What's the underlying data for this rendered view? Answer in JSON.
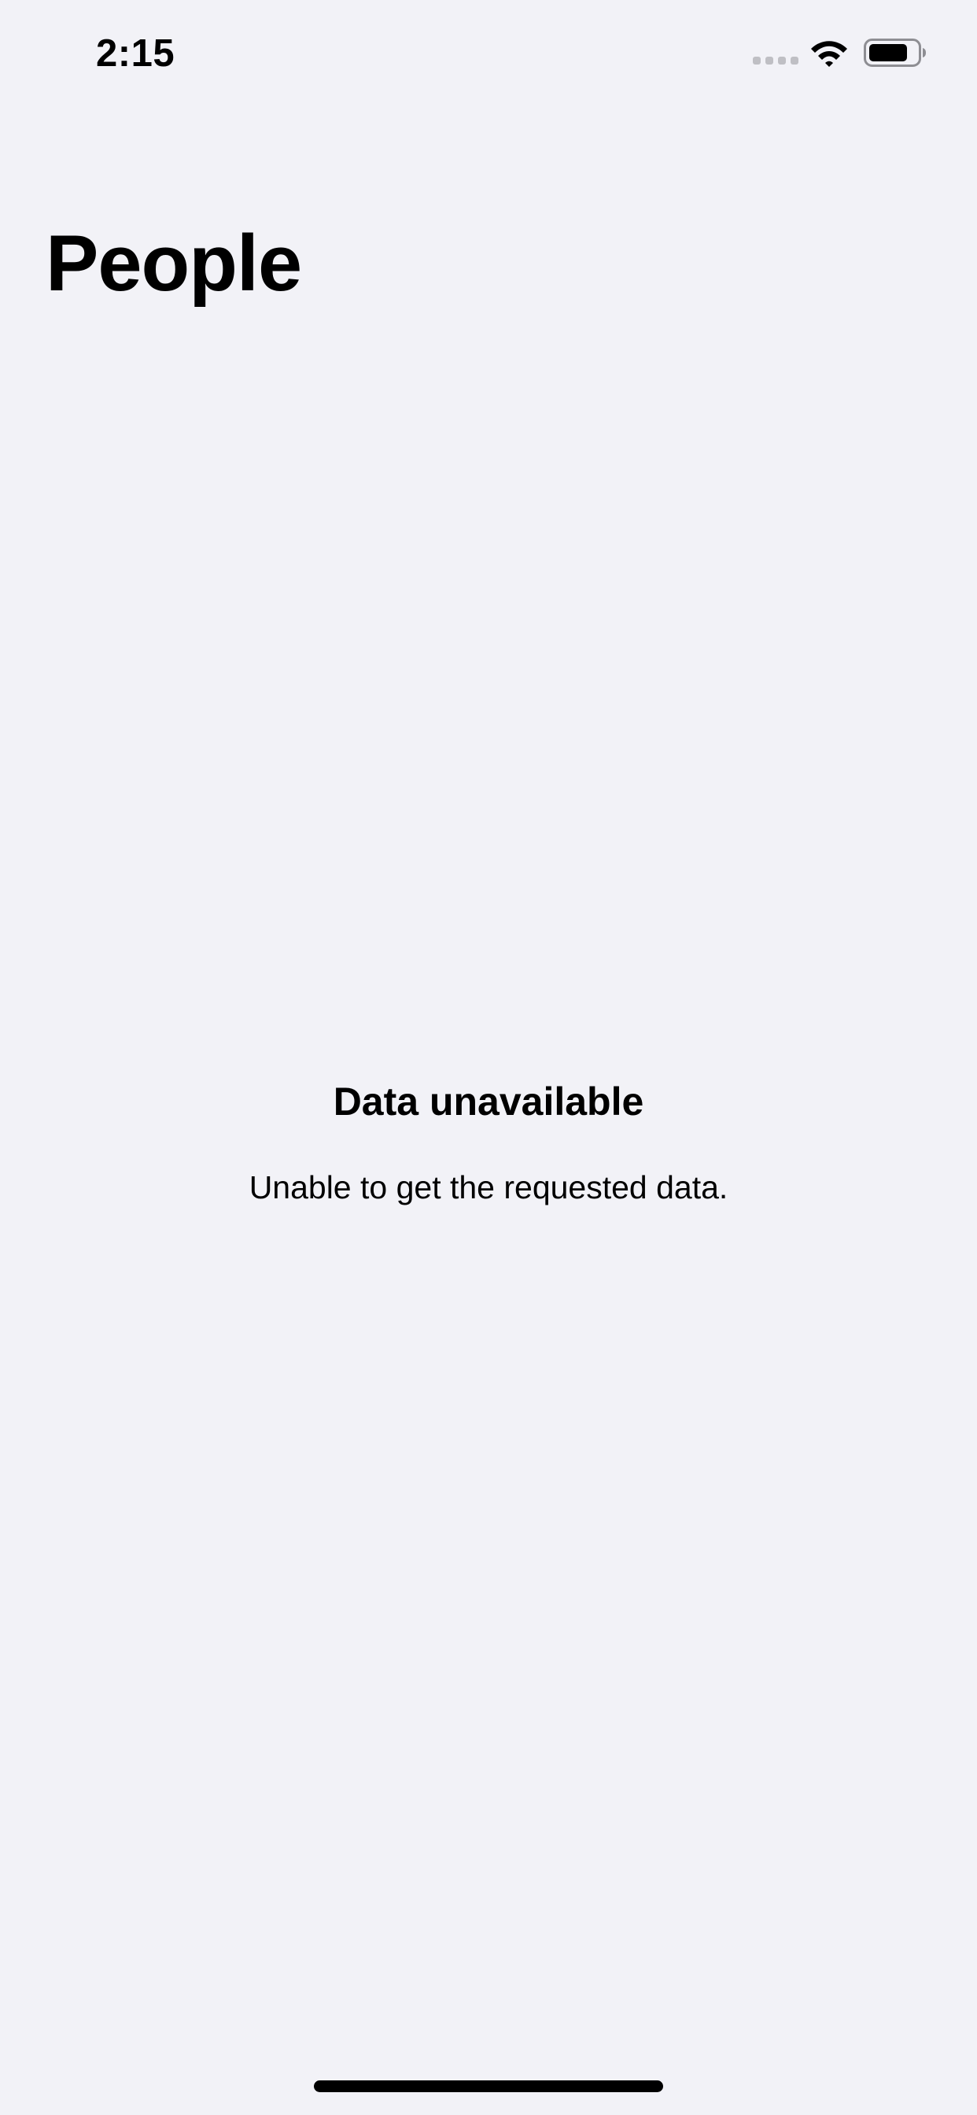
{
  "status_bar": {
    "time": "2:15",
    "icons": [
      "cellular-signal-icon",
      "wifi-icon",
      "battery-icon"
    ]
  },
  "navigation": {
    "large_title": "People"
  },
  "empty_state": {
    "title": "Data unavailable",
    "message": "Unable to get the requested data."
  },
  "colors": {
    "background": "#f2f2f7",
    "text": "#000000",
    "inactive_signal": "#bfbfc4"
  }
}
